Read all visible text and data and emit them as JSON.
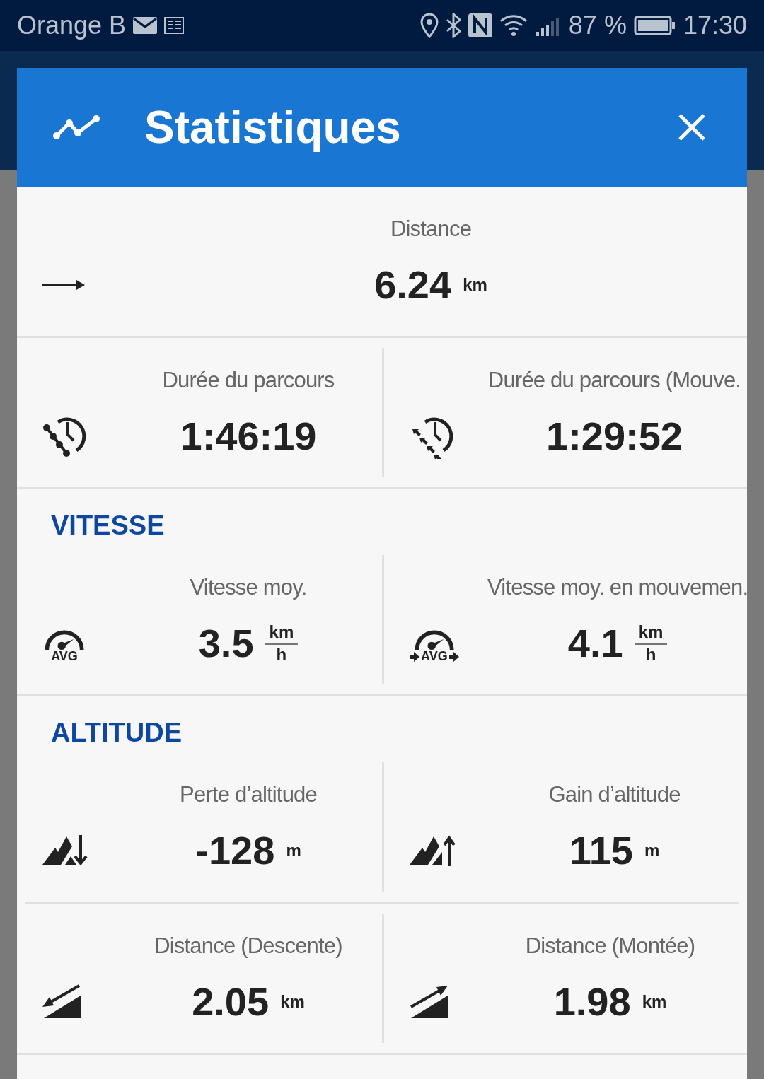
{
  "status_bar": {
    "carrier": "Orange B",
    "battery": "87 %",
    "time": "17:30"
  },
  "dialog": {
    "title": "Statistiques"
  },
  "sections": [
    {
      "rows": [
        {
          "cells": [
            {
              "kind": "arrow",
              "label": "Distance",
              "value": "6.24",
              "unit": "km"
            }
          ]
        }
      ]
    },
    {
      "rows": [
        {
          "cells": [
            {
              "kind": "clock-track",
              "label": "Durée du parcours",
              "value": "1:46:19"
            },
            {
              "kind": "clock-moving",
              "label": "Durée du parcours (Mouve.",
              "value": "1:29:52"
            }
          ]
        }
      ]
    },
    {
      "title": "VITESSE",
      "rows": [
        {
          "cells": [
            {
              "kind": "gauge",
              "icon_label": "AVG",
              "label": "Vitesse moy.",
              "value": "3.5",
              "unit": "km",
              "unit_denominator": "h"
            },
            {
              "kind": "gauge-moving",
              "icon_label": "AVG",
              "label": "Vitesse moy. en mouvemen.",
              "value": "4.1",
              "unit": "km",
              "unit_denominator": "h"
            }
          ]
        }
      ]
    },
    {
      "title": "ALTITUDE",
      "rows": [
        {
          "cells": [
            {
              "kind": "mountain-down",
              "label": "Perte d’altitude",
              "value": "-128",
              "unit": "m"
            },
            {
              "kind": "mountain-up",
              "label": "Gain d’altitude",
              "value": "115",
              "unit": "m"
            }
          ]
        },
        {
          "cells": [
            {
              "kind": "slope-down",
              "label": "Distance (Descente)",
              "value": "2.05",
              "unit": "km"
            },
            {
              "kind": "slope-up",
              "label": "Distance (Montée)",
              "value": "1.98",
              "unit": "km"
            }
          ]
        }
      ]
    }
  ]
}
